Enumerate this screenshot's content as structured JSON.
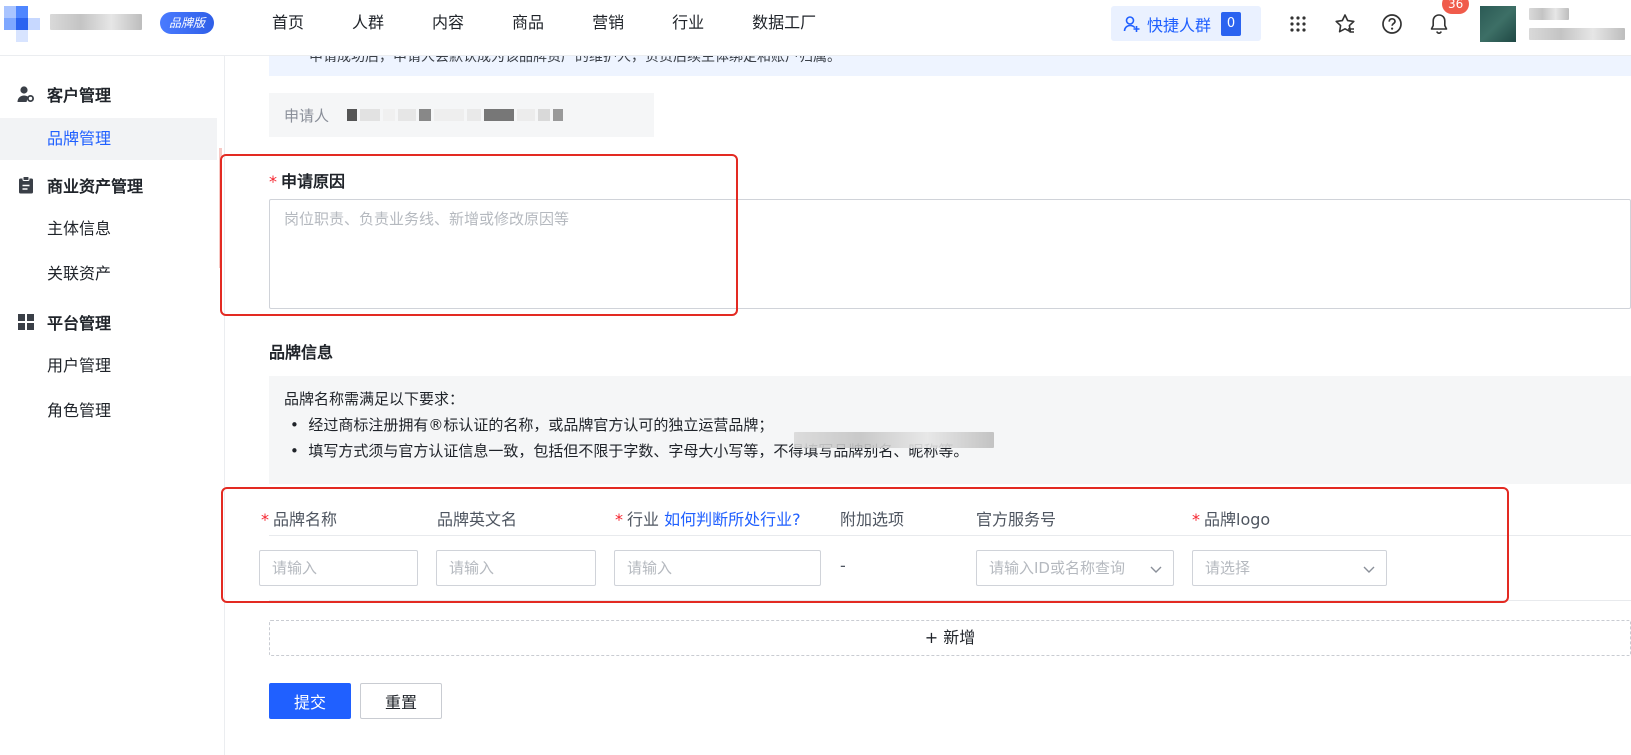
{
  "header": {
    "edition_badge": "品牌版",
    "nav": [
      "首页",
      "人群",
      "内容",
      "商品",
      "营销",
      "行业",
      "数据工厂"
    ],
    "quick_audience": {
      "label": "快捷人群",
      "count": "0"
    },
    "notification_count": "36",
    "icons": [
      "apps-grid-icon",
      "star-list-icon",
      "help-icon",
      "bell-icon"
    ]
  },
  "sidebar": {
    "groups": [
      {
        "label": "客户管理",
        "icon": "user-settings-icon",
        "items": [
          "品牌管理"
        ]
      },
      {
        "label": "商业资产管理",
        "icon": "clipboard-icon",
        "items": [
          "主体信息",
          "关联资产"
        ]
      },
      {
        "label": "平台管理",
        "icon": "grid-icon",
        "items": [
          "用户管理",
          "角色管理"
        ]
      }
    ],
    "active_item": "品牌管理"
  },
  "form": {
    "notice_partial": "申请成功后，申请人会默认成为该品牌资产的维护人，负责后续主体绑定和账户归属。",
    "applicant_label": "申请人",
    "reason": {
      "label": "申请原因",
      "required": true,
      "placeholder": "岗位职责、负责业务线、新增或修改原因等"
    },
    "brand_section_title": "品牌信息",
    "rules": {
      "title": "品牌名称需满足以下要求：",
      "items": [
        "经过商标注册拥有®标认证的名称，或品牌官方认可的独立运营品牌；",
        "填写方式须与官方认证信息一致，包括但不限于字数、字母大小写等，不得填写品牌别名、昵称等。"
      ]
    },
    "columns": {
      "brand_name": "品牌名称",
      "brand_en_name": "品牌英文名",
      "industry": "行业",
      "industry_help_link": "如何判断所处行业?",
      "extra_options": "附加选项",
      "official_account": "官方服务号",
      "brand_logo": "品牌logo"
    },
    "row": {
      "brand_name_placeholder": "请输入",
      "brand_en_name_placeholder": "请输入",
      "industry_placeholder": "请输入",
      "extra_options_value": "-",
      "official_account_placeholder": "请输入ID或名称查询",
      "brand_logo_placeholder": "请选择"
    },
    "add_row_label": "+ 新增",
    "submit_label": "提交",
    "reset_label": "重置"
  }
}
